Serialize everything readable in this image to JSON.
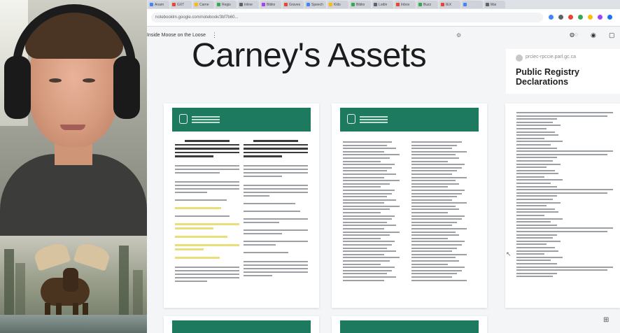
{
  "browser": {
    "tabs": [
      {
        "label": "Anam",
        "color": "#4285f4"
      },
      {
        "label": "GXT",
        "color": "#ea4335"
      },
      {
        "label": "Carne",
        "color": "#fbbc04"
      },
      {
        "label": "Regis",
        "color": "#34a853"
      },
      {
        "label": "Inline",
        "color": "#5f6368"
      },
      {
        "label": "Biblio",
        "color": "#a142f4"
      },
      {
        "label": "Graves",
        "color": "#ea4335"
      },
      {
        "label": "Speech",
        "color": "#4285f4"
      },
      {
        "label": "Kids",
        "color": "#fbbc04"
      },
      {
        "label": "Biblio",
        "color": "#34a853"
      },
      {
        "label": "Lodin",
        "color": "#5f6368"
      },
      {
        "label": "Inbox",
        "color": "#ea4335"
      },
      {
        "label": "Buzz",
        "color": "#34a853"
      },
      {
        "label": "IEX",
        "color": "#ea4335"
      },
      {
        "label": "",
        "color": "#4285f4"
      },
      {
        "label": "Mai",
        "color": "#5f6368"
      }
    ],
    "url": "notebooklm.google.com/notebook/3bf7b60..."
  },
  "toolbar": {
    "doc_name": "Inside Moose on the Loose",
    "kebab": "⋮"
  },
  "page": {
    "title": "Carney's Assets"
  },
  "registry": {
    "url": "prciec-rpccie.parl.gc.ca",
    "title": "Public Registry Declarations"
  },
  "icons": {
    "gear": "⚙",
    "share": "👥",
    "grid": "⊞",
    "cursor": "↖"
  }
}
